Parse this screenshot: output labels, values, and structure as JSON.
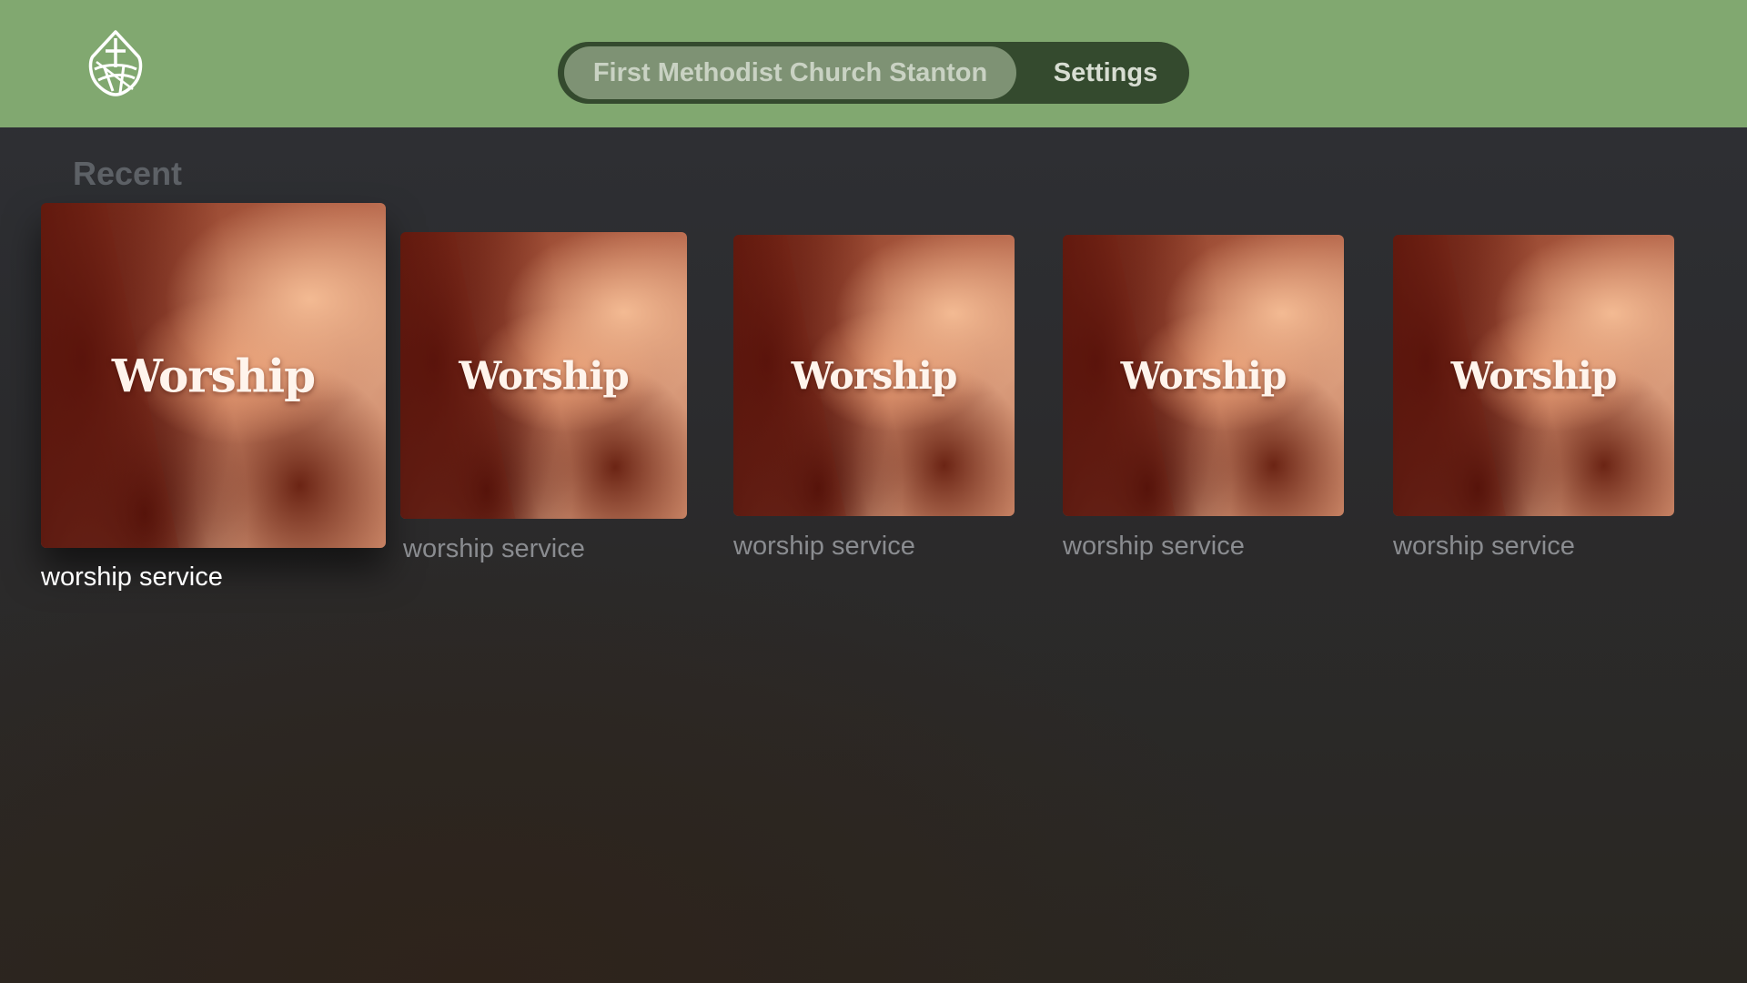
{
  "header": {
    "logo_icon": "church-globe-logo-icon",
    "tabs": [
      {
        "label": "First Methodist Church Stanton",
        "selected": true
      },
      {
        "label": "Settings",
        "selected": false
      }
    ]
  },
  "main": {
    "section_title": "Recent",
    "items": [
      {
        "thumbnail_text": "Worship",
        "label": "worship service",
        "focused": true
      },
      {
        "thumbnail_text": "Worship",
        "label": "worship service",
        "focused": false
      },
      {
        "thumbnail_text": "Worship",
        "label": "worship service",
        "focused": false
      },
      {
        "thumbnail_text": "Worship",
        "label": "worship service",
        "focused": false
      },
      {
        "thumbnail_text": "Worship",
        "label": "worship service",
        "focused": false
      }
    ]
  },
  "colors": {
    "header_bg": "#81a870",
    "tabbar_bg": "#344a2e",
    "selected_tab_bg": "#7e9274",
    "page_bg": "#2c2d30"
  }
}
